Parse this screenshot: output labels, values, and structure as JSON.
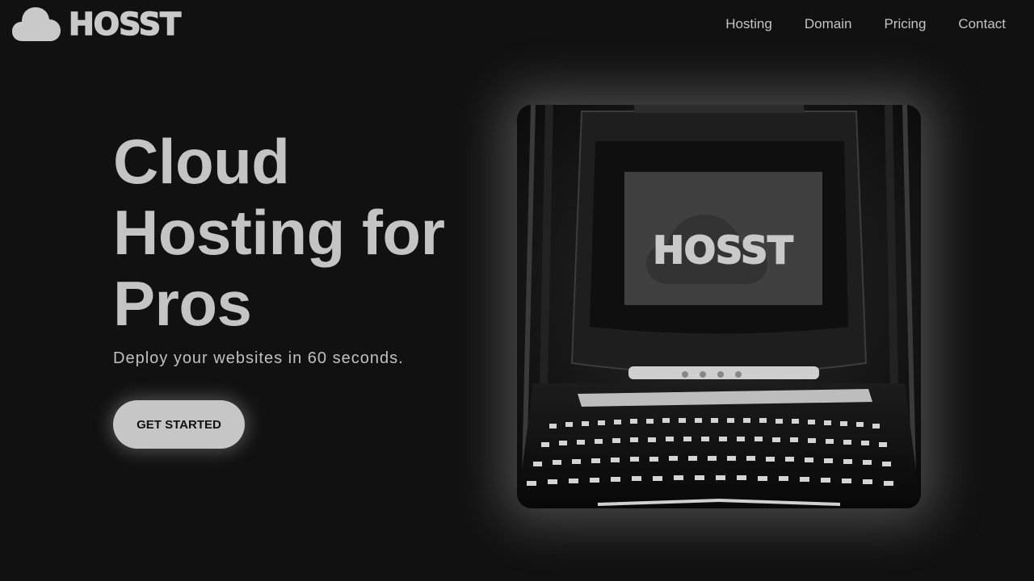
{
  "header": {
    "brand": "HOSST",
    "nav": [
      "Hosting",
      "Domain",
      "Pricing",
      "Contact"
    ]
  },
  "hero": {
    "title_lines": [
      "Cloud",
      "Hosting for",
      "Pros"
    ],
    "subtitle": "Deploy your websites in 60 seconds.",
    "cta_label": "GET STARTED"
  },
  "image": {
    "screen_brand": "HOSST"
  },
  "colors": {
    "background": "#111111",
    "text": "#c4c4c4",
    "button_bg": "#c6c6c6",
    "button_text": "#111111"
  }
}
